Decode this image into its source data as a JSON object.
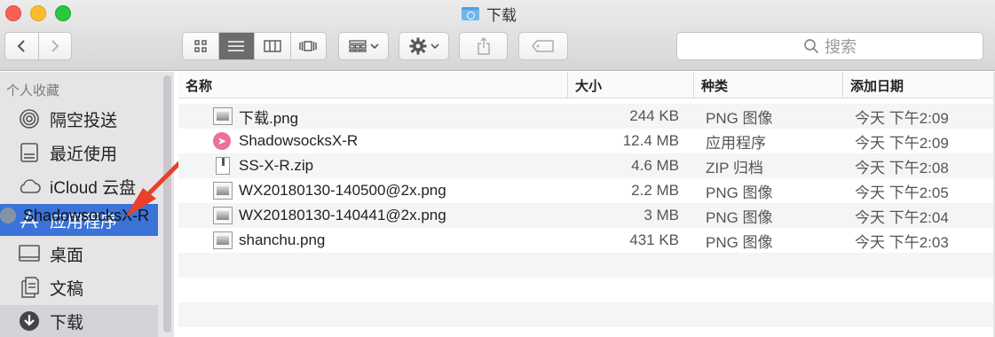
{
  "window": {
    "title": "下载"
  },
  "toolbar": {
    "back_icon": "chevron-left",
    "forward_icon": "chevron-right",
    "view_modes": [
      "icon",
      "list",
      "column",
      "cover-flow"
    ],
    "active_view": "list",
    "search_placeholder": "搜索"
  },
  "sidebar": {
    "section_title": "个人收藏",
    "items": [
      {
        "label": "隔空投送",
        "icon": "airdrop-icon"
      },
      {
        "label": "最近使用",
        "icon": "recents-icon"
      },
      {
        "label": "iCloud 云盘",
        "icon": "cloud-icon"
      },
      {
        "label": "应用程序",
        "icon": "applications-icon",
        "selected": true
      },
      {
        "label": "桌面",
        "icon": "desktop-icon"
      },
      {
        "label": "文稿",
        "icon": "documents-icon"
      },
      {
        "label": "下载",
        "icon": "downloads-icon"
      }
    ],
    "drag_label": "ShadowsocksX-R"
  },
  "columns": {
    "name": "名称",
    "size": "大小",
    "kind": "种类",
    "date": "添加日期"
  },
  "files": [
    {
      "name": "下载.png",
      "size": "244 KB",
      "kind": "PNG 图像",
      "date": "今天 下午2:09",
      "icon": "image-file-icon"
    },
    {
      "name": "ShadowsocksX-R",
      "size": "12.4 MB",
      "kind": "应用程序",
      "date": "今天 下午2:09",
      "icon": "app-icon"
    },
    {
      "name": "SS-X-R.zip",
      "size": "4.6 MB",
      "kind": "ZIP 归档",
      "date": "今天 下午2:08",
      "icon": "zip-file-icon"
    },
    {
      "name": "WX20180130-140500@2x.png",
      "size": "2.2 MB",
      "kind": "PNG 图像",
      "date": "今天 下午2:05",
      "icon": "image-file-icon"
    },
    {
      "name": "WX20180130-140441@2x.png",
      "size": "3 MB",
      "kind": "PNG 图像",
      "date": "今天 下午2:04",
      "icon": "image-file-icon"
    },
    {
      "name": "shanchu.png",
      "size": "431 KB",
      "kind": "PNG 图像",
      "date": "今天 下午2:03",
      "icon": "image-file-icon"
    }
  ],
  "colors": {
    "selection": "#3b73d8",
    "arrow": "#e8402a",
    "sidebar_bg": "#e6e4e7"
  }
}
